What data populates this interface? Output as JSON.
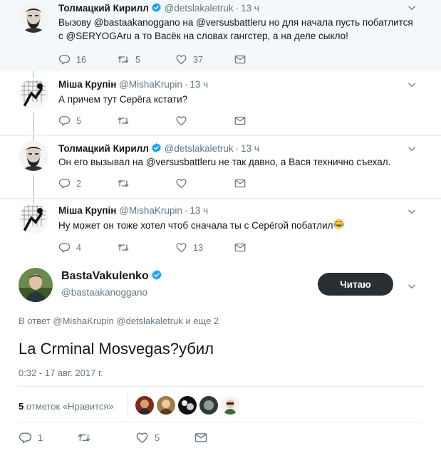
{
  "tweets": [
    {
      "name": "Толмацкий Кирилл",
      "handle": "@detslakaletruk",
      "time": "13 ч",
      "verified": true,
      "text": "Вызову @bastaakanoggano на @versusbattleru но для начала пусть побатлится с @SERYOGAru а то Васёк на словах гангстер, а на деле сыкло!",
      "replies": "16",
      "retweets": "5",
      "likes": "37"
    },
    {
      "name": "Міша Крупін",
      "handle": "@MishaKrupin",
      "time": "13 ч",
      "verified": false,
      "text": "А причем тут Серёга кстати?",
      "replies": "5",
      "retweets": "",
      "likes": ""
    },
    {
      "name": "Толмацкий Кирилл",
      "handle": "@detslakaletruk",
      "time": "13 ч",
      "verified": true,
      "text": "Он его вызывал на @versusbattleru не так давно, а Вася технично съехал.",
      "replies": "2",
      "retweets": "",
      "likes": ""
    },
    {
      "name": "Міша Крупін",
      "handle": "@MishaKrupin",
      "time": "13 ч",
      "verified": false,
      "text": "Ну может он тоже хотел чтоб сначала ты с Серёгой побатлил",
      "emoji": "tears-of-joy-emoji",
      "replies": "4",
      "retweets": "",
      "likes": "13"
    }
  ],
  "main": {
    "name": "BastaVakulenko",
    "handle": "@bastaakanoggano",
    "follow_label": "Читаю",
    "reply_prefix": "В ответ",
    "reply_users": "@MishaKrupin @detslakaletruk",
    "reply_more": "и еще 2",
    "text": "La Crminal Mosvegas?убил",
    "date": "0:32 - 17 авг. 2017 г.",
    "likes_count": "5",
    "likes_label": "отметок «Нравится»",
    "replies": "1",
    "retweets": "",
    "likes": "5"
  },
  "colors": {
    "accent": "#1da1f2",
    "text": "#14171a",
    "muted": "#657786",
    "follow_bg": "#292f33",
    "thread_line": "#ccd6dd",
    "highlight_bg": "#f5f8fa"
  },
  "icons": [
    "reply-icon",
    "retweet-icon",
    "like-icon",
    "direct-message-icon",
    "chevron-down-icon",
    "verified-badge-icon"
  ]
}
